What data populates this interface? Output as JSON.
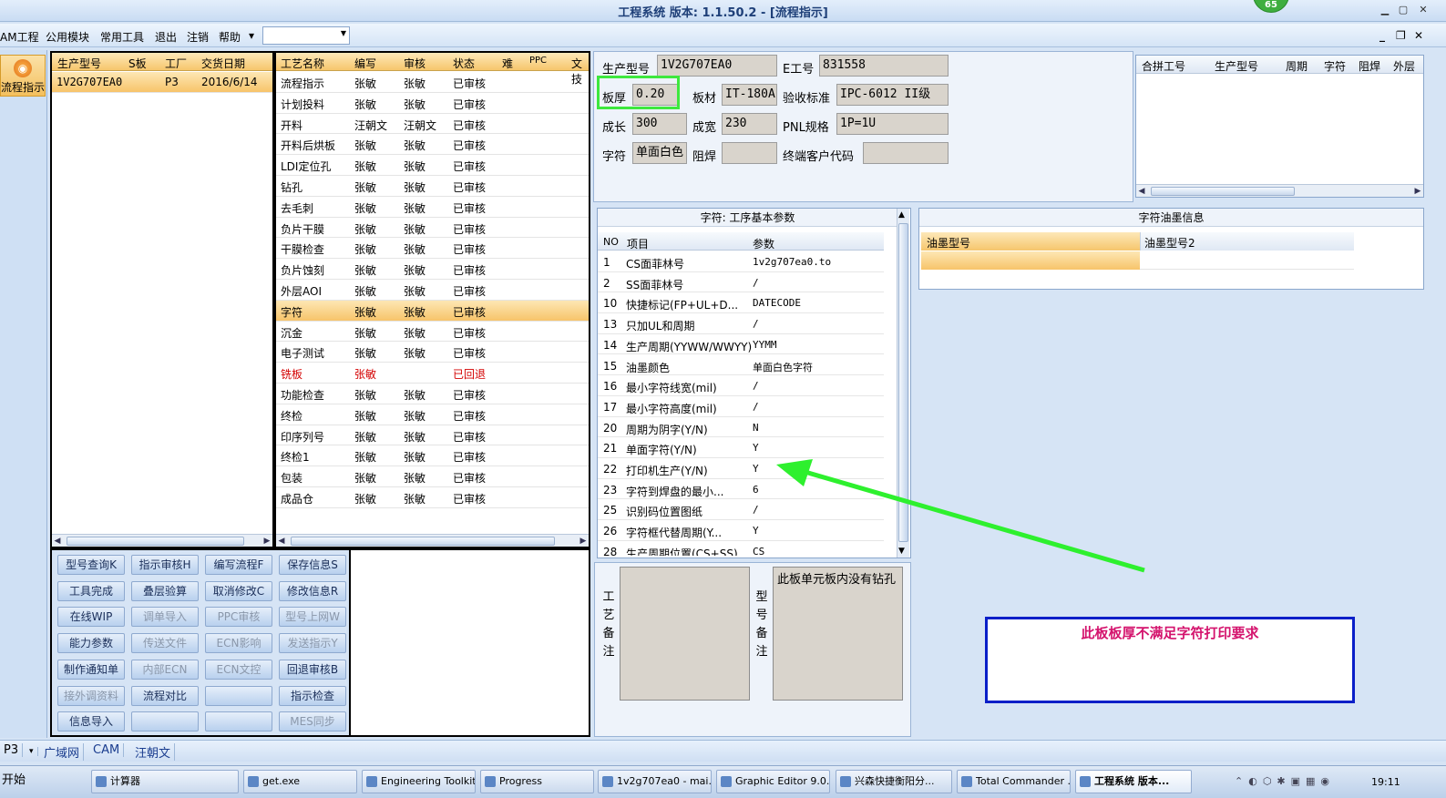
{
  "window": {
    "title": "工程系统   版本: 1.1.50.2 - [流程指示]",
    "badge": "65"
  },
  "menu": [
    "AM工程",
    "公用模块",
    "常用工具",
    "退出",
    "注销",
    "帮助"
  ],
  "nav": {
    "label": "流程指示"
  },
  "orders": {
    "headers": [
      "生产型号",
      "S板",
      "工厂",
      "交货日期"
    ],
    "rows": [
      {
        "model": "1V2G707EA0",
        "sboard": "",
        "factory": "P3",
        "date": "2016/6/14"
      }
    ]
  },
  "process": {
    "headers": [
      "工艺名称",
      "编写",
      "审核",
      "状态",
      "难",
      "PPC",
      "文技"
    ],
    "rows": [
      {
        "name": "流程指示",
        "writer": "张敏",
        "reviewer": "张敏",
        "status": "已审核"
      },
      {
        "name": "计划投料",
        "writer": "张敏",
        "reviewer": "张敏",
        "status": "已审核"
      },
      {
        "name": "开料",
        "writer": "汪朝文",
        "reviewer": "汪朝文",
        "status": "已审核"
      },
      {
        "name": "开料后烘板",
        "writer": "张敏",
        "reviewer": "张敏",
        "status": "已审核"
      },
      {
        "name": "LDI定位孔",
        "writer": "张敏",
        "reviewer": "张敏",
        "status": "已审核"
      },
      {
        "name": "钻孔",
        "writer": "张敏",
        "reviewer": "张敏",
        "status": "已审核"
      },
      {
        "name": "去毛刺",
        "writer": "张敏",
        "reviewer": "张敏",
        "status": "已审核"
      },
      {
        "name": "负片干膜",
        "writer": "张敏",
        "reviewer": "张敏",
        "status": "已审核"
      },
      {
        "name": "干膜检查",
        "writer": "张敏",
        "reviewer": "张敏",
        "status": "已审核"
      },
      {
        "name": "负片蚀刻",
        "writer": "张敏",
        "reviewer": "张敏",
        "status": "已审核"
      },
      {
        "name": "外层AOI",
        "writer": "张敏",
        "reviewer": "张敏",
        "status": "已审核"
      },
      {
        "name": "字符",
        "writer": "张敏",
        "reviewer": "张敏",
        "status": "已审核"
      },
      {
        "name": "沉金",
        "writer": "张敏",
        "reviewer": "张敏",
        "status": "已审核"
      },
      {
        "name": "电子测试",
        "writer": "张敏",
        "reviewer": "张敏",
        "status": "已审核"
      },
      {
        "name": "铣板",
        "writer": "张敏",
        "reviewer": "",
        "status": "已回退"
      },
      {
        "name": "功能检查",
        "writer": "张敏",
        "reviewer": "张敏",
        "status": "已审核"
      },
      {
        "name": "终检",
        "writer": "张敏",
        "reviewer": "张敏",
        "status": "已审核"
      },
      {
        "name": "印序列号",
        "writer": "张敏",
        "reviewer": "张敏",
        "status": "已审核"
      },
      {
        "name": "终检1",
        "writer": "张敏",
        "reviewer": "张敏",
        "status": "已审核"
      },
      {
        "name": "包装",
        "writer": "张敏",
        "reviewer": "张敏",
        "status": "已审核"
      },
      {
        "name": "成品仓",
        "writer": "张敏",
        "reviewer": "张敏",
        "status": "已审核"
      }
    ]
  },
  "buttons": [
    [
      "型号查询K",
      "指示审核H",
      "编写流程F",
      "保存信息S"
    ],
    [
      "工具完成",
      "叠层验算",
      "取消修改C",
      "修改信息R"
    ],
    [
      "在线WIP",
      "调单导入",
      "PPC审核",
      "型号上网W"
    ],
    [
      "能力参数",
      "传送文件",
      "ECN影响",
      "发送指示Y"
    ],
    [
      "制作通知单",
      "内部ECN",
      "ECN文控",
      "回退审核B"
    ],
    [
      "接外调资料",
      "流程对比",
      "",
      "指示检查"
    ],
    [
      "信息导入",
      "",
      "",
      "MES同步"
    ]
  ],
  "info": {
    "model_label": "生产型号",
    "model": "1V2G707EA0",
    "e_label": "E工号",
    "e_no": "831558",
    "thick_label": "板厚",
    "thick": "0.20",
    "mat_label": "板材",
    "mat": "IT-180A",
    "std_label": "验收标准",
    "std": "IPC-6012 II级",
    "len_label": "成长",
    "len": "300",
    "wid_label": "成宽",
    "wid": "230",
    "pnl_label": "PNL规格",
    "pnl": "1P=1U",
    "char_label": "字符",
    "char": "单面白色",
    "mask_label": "阻焊",
    "mask": "",
    "cust_label": "终端客户代码",
    "cust": ""
  },
  "merge": {
    "headers": [
      "合拼工号",
      "生产型号",
      "周期",
      "字符",
      "阻焊",
      "外层"
    ]
  },
  "params": {
    "title": "字符: 工序基本参数",
    "headers": [
      "NO",
      "项目",
      "参数"
    ],
    "rows": [
      {
        "no": "1",
        "item": "CS面菲林号",
        "val": "1v2g707ea0.to"
      },
      {
        "no": "2",
        "item": "SS面菲林号",
        "val": "/"
      },
      {
        "no": "10",
        "item": "快捷标记(FP+UL+D...",
        "val": "DATECODE"
      },
      {
        "no": "13",
        "item": "只加UL和周期",
        "val": "/"
      },
      {
        "no": "14",
        "item": "生产周期(YYWW/WWYY)",
        "val": "YYMM"
      },
      {
        "no": "15",
        "item": "油墨颜色",
        "val": "单面白色字符"
      },
      {
        "no": "16",
        "item": "最小字符线宽(mil)",
        "val": "/"
      },
      {
        "no": "17",
        "item": "最小字符高度(mil)",
        "val": "/"
      },
      {
        "no": "20",
        "item": "周期为阴字(Y/N)",
        "val": "N"
      },
      {
        "no": "21",
        "item": "单面字符(Y/N)",
        "val": "Y"
      },
      {
        "no": "22",
        "item": "打印机生产(Y/N)",
        "val": "Y"
      },
      {
        "no": "23",
        "item": "字符到焊盘的最小...",
        "val": "6"
      },
      {
        "no": "25",
        "item": "识别码位置图纸",
        "val": "/"
      },
      {
        "no": "26",
        "item": "字符框代替周期(Y...",
        "val": "Y"
      },
      {
        "no": "28",
        "item": "生产周期位置(CS+SS)",
        "val": "CS"
      }
    ]
  },
  "ink": {
    "title": "字符油墨信息",
    "headers": [
      "油墨型号",
      "油墨型号2"
    ]
  },
  "remarks": {
    "proc_label": [
      "工",
      "艺",
      "备",
      "注"
    ],
    "model_label": [
      "型",
      "号",
      "备",
      "注"
    ],
    "proc_text": "",
    "model_text": "此板单元板内没有钻孔"
  },
  "annotation": {
    "text": "此板板厚不满足字符打印要求"
  },
  "status": [
    "P3",
    "广域网",
    "CAM",
    "汪朝文"
  ],
  "taskbar": {
    "start": "开始",
    "tasks": [
      "计算器",
      "get.exe",
      "Engineering Toolkit...",
      "Progress",
      "1v2g707ea0 - mai...",
      "Graphic Editor 9.0...",
      "兴森快捷衡阳分...",
      "Total Commander ...",
      "工程系统  版本..."
    ],
    "clock": "19:11"
  },
  "colors": {
    "accent": "#f6c66c",
    "annotation_border": "#0a1fc8",
    "annotation_text": "#d4136d",
    "highlight": "#3ee83e"
  }
}
